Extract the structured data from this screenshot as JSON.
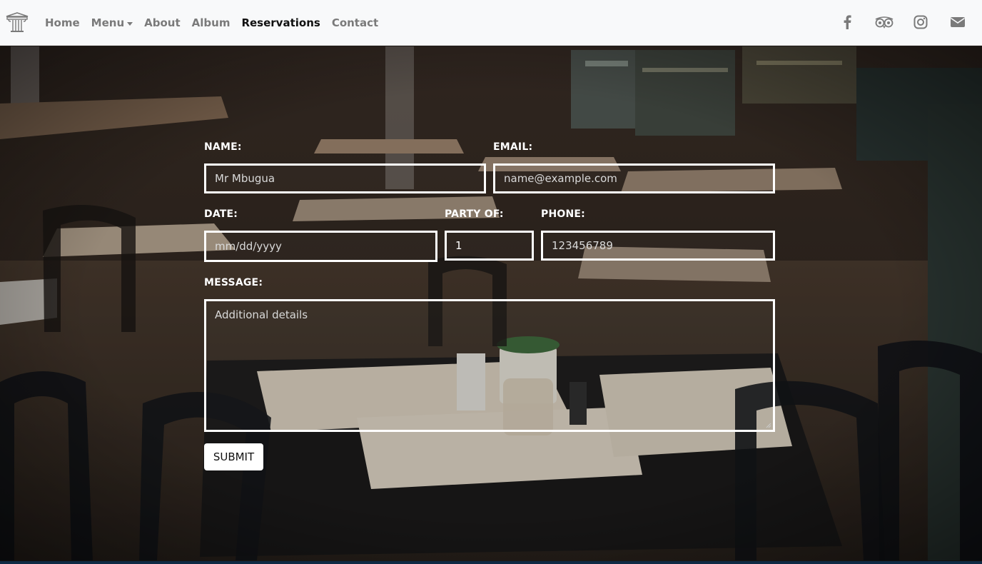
{
  "navbar": {
    "brand_icon": "pillar-logo-icon",
    "links": [
      {
        "label": "Home",
        "active": false
      },
      {
        "label": "Menu",
        "active": false,
        "dropdown": true
      },
      {
        "label": "About",
        "active": false
      },
      {
        "label": "Album",
        "active": false
      },
      {
        "label": "Reservations",
        "active": true
      },
      {
        "label": "Contact",
        "active": false
      }
    ],
    "socials": [
      "facebook-icon",
      "tripadvisor-icon",
      "instagram-icon",
      "envelope-icon"
    ]
  },
  "form": {
    "name": {
      "label": "NAME:",
      "placeholder": "Mr Mbugua"
    },
    "email": {
      "label": "EMAIL:",
      "placeholder": "name@example.com"
    },
    "date": {
      "label": "DATE:",
      "placeholder": "mm/dd/yyyy"
    },
    "party": {
      "label": "PARTY OF:",
      "value": "1"
    },
    "phone": {
      "label": "PHONE:",
      "placeholder": "123456789"
    },
    "message": {
      "label": "MESSAGE:",
      "placeholder": "Additional details"
    },
    "submit_label": "SUBMIT"
  },
  "colors": {
    "nav_bg": "#f8f9fa",
    "nav_link": "#7a7a7a",
    "nav_active": "#111111",
    "form_border": "#ffffff",
    "footer_strip": "#0f2a44"
  }
}
